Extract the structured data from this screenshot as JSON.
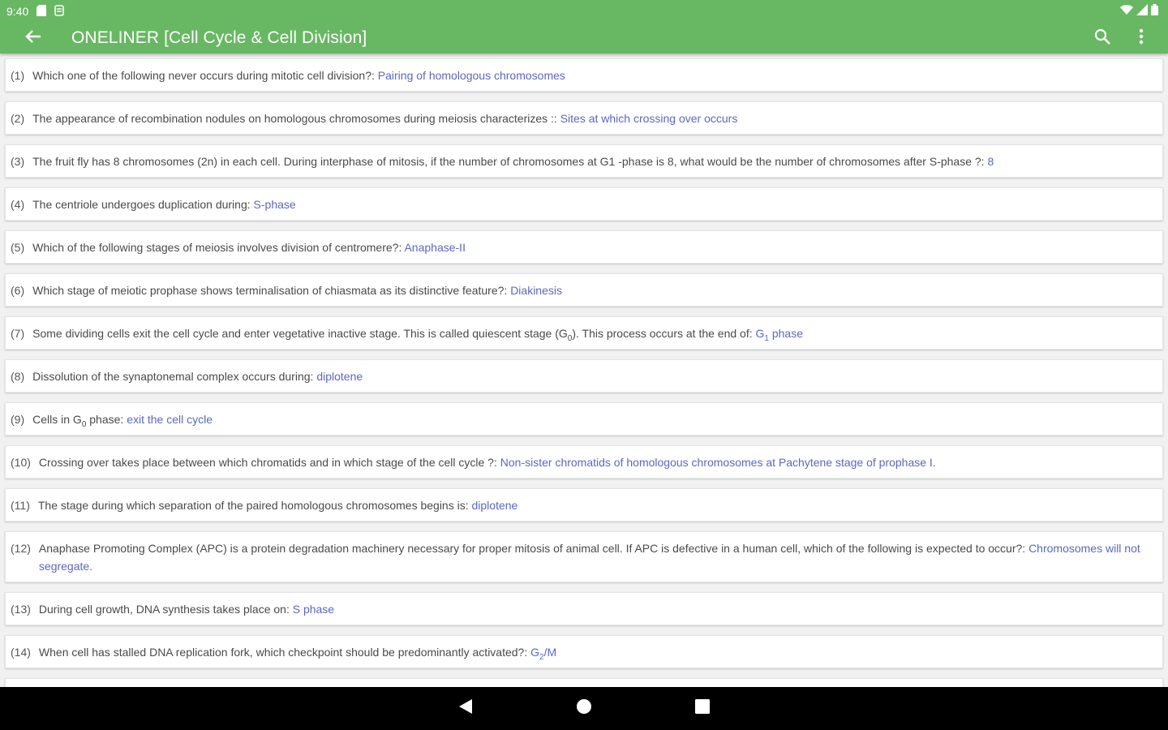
{
  "status_bar": {
    "time": "9:40"
  },
  "app_bar": {
    "title": "ONELINER [Cell Cycle & Cell Division]"
  },
  "colors": {
    "accent": "#68b863",
    "answer": "#5b67c4",
    "text": "#4a4a4a"
  },
  "icons": {
    "back": "arrow-left-icon",
    "search": "search-icon",
    "more": "more-vert-icon",
    "nav_back": "triangle-back-icon",
    "nav_home": "circle-home-icon",
    "nav_recents": "square-recents-icon"
  },
  "items": [
    {
      "num": "(1)",
      "question": "Which one of the following never occurs during mitotic cell division?: ",
      "answer": "Pairing of homologous chromosomes"
    },
    {
      "num": "(2)",
      "question": "The appearance of recombination nodules on homologous chromosomes during meiosis characterizes :: ",
      "answer": "Sites at which crossing over occurs"
    },
    {
      "num": "(3)",
      "question": "The fruit fly has 8 chromosomes (2n) in each cell. During interphase of mitosis, if the number of chromosomes at G1 -phase is 8, what would be the number of chromosomes after S-phase ?: ",
      "answer": "8"
    },
    {
      "num": "(4)",
      "question": "The centriole undergoes duplication during: ",
      "answer": "S-phase"
    },
    {
      "num": "(5)",
      "question": "Which of the following stages of meiosis involves division of centromere?: ",
      "answer": "Anaphase-II"
    },
    {
      "num": "(6)",
      "question": "Which stage of meiotic prophase shows terminalisation of chiasmata as its distinctive feature?: ",
      "answer": "Diakinesis"
    },
    {
      "num": "(7)",
      "question_pre": "Some dividing cells exit the cell cycle and enter vegetative inactive stage. This is called quiescent stage (G",
      "question_sub": "0",
      "question_post": "). This process occurs at the end of: ",
      "answer_pre": "G",
      "answer_sub": "1",
      "answer_post": " phase"
    },
    {
      "num": "(8)",
      "question": "Dissolution of the synaptonemal complex occurs during: ",
      "answer": "diplotene"
    },
    {
      "num": "(9)",
      "question_pre": "Cells in G",
      "question_sub": "0",
      "question_post": " phase: ",
      "answer": "exit the cell cycle"
    },
    {
      "num": "(10)",
      "question": "Crossing over takes place between which chromatids and in which stage of the cell cycle ?: ",
      "answer": "Non-sister chromatids of homologous chromosomes at Pachytene stage of prophase I."
    },
    {
      "num": "(11)",
      "question": "The stage during which separation of the paired homologous chromosomes begins is: ",
      "answer": "diplotene"
    },
    {
      "num": "(12)",
      "question": "Anaphase Promoting Complex (APC) is a protein degradation machinery necessary for proper mitosis of animal cell. If APC is defective in a human cell, which of the following is expected to occur?: ",
      "answer": "Chromosomes will not segregate."
    },
    {
      "num": "(13)",
      "question": "During cell growth, DNA synthesis takes place on: ",
      "answer": "S phase"
    },
    {
      "num": "(14)",
      "question": "When cell has stalled DNA replication fork, which checkpoint should be predominantly activated?: ",
      "answer_pre": "G",
      "answer_sub": "2",
      "answer_post": "/M"
    }
  ]
}
